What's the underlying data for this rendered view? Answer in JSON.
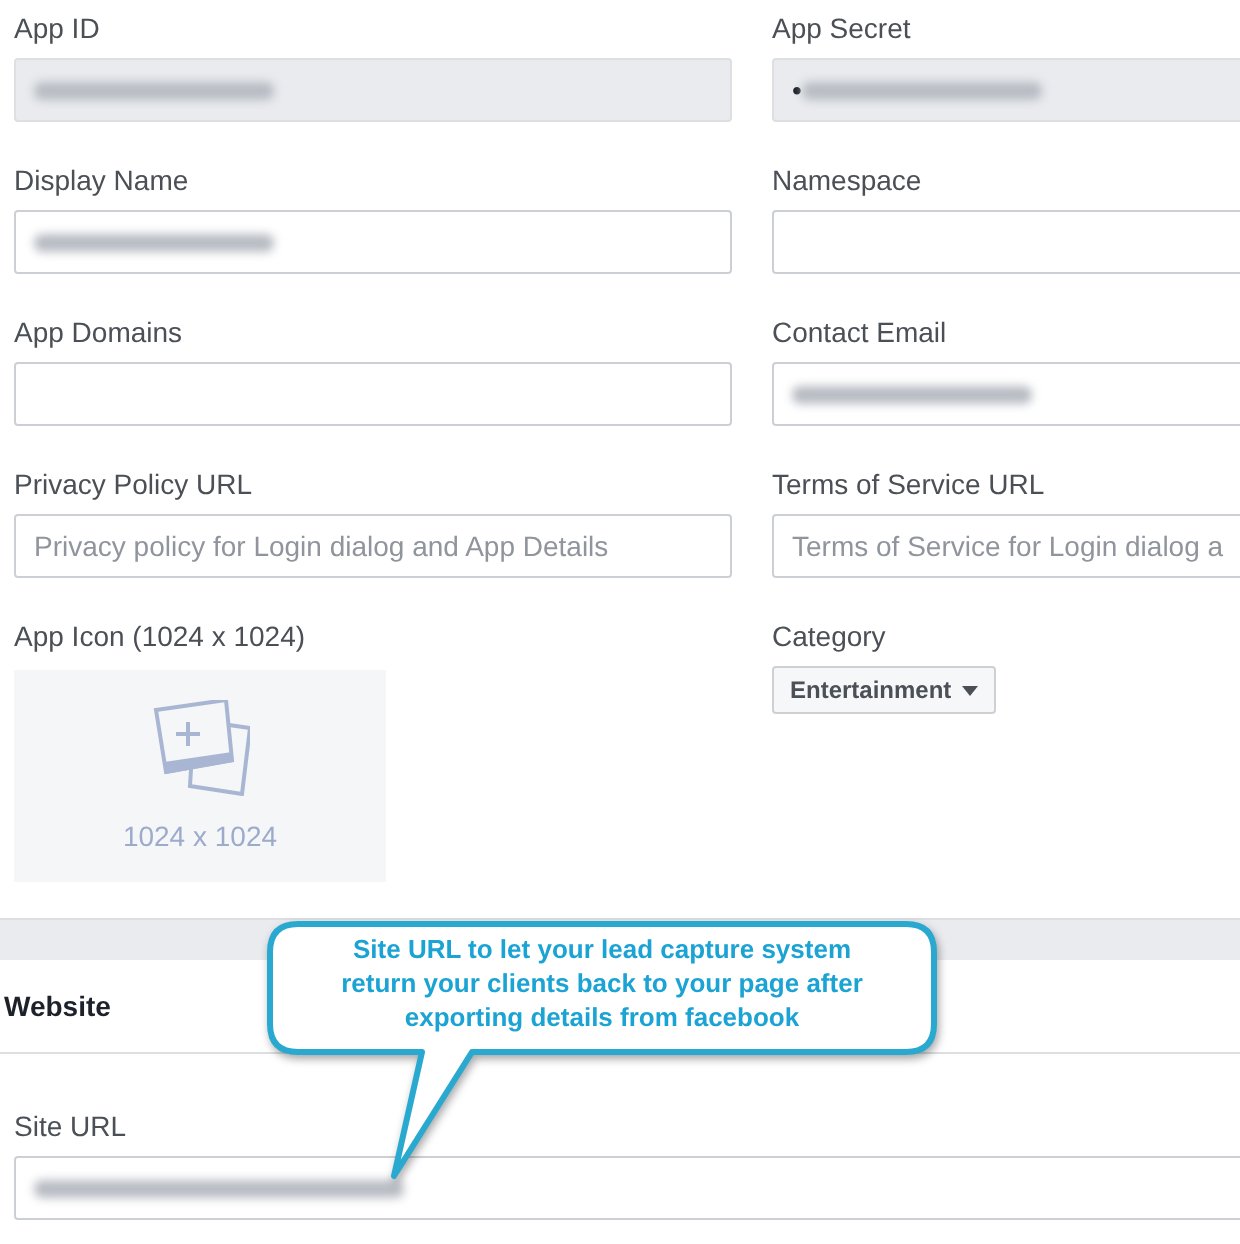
{
  "fields": [
    {
      "label": "App ID",
      "kind": "readonly",
      "redacted": true
    },
    {
      "label": "App Secret",
      "kind": "readonly",
      "value": "•",
      "redacted": true
    },
    {
      "label": "Display Name",
      "kind": "text",
      "redacted": true
    },
    {
      "label": "Namespace",
      "kind": "text"
    },
    {
      "label": "App Domains",
      "kind": "text"
    },
    {
      "label": "Contact Email",
      "kind": "text",
      "redacted": true
    },
    {
      "label": "Privacy Policy URL",
      "kind": "text",
      "placeholder": "Privacy policy for Login dialog and App Details"
    },
    {
      "label": "Terms of Service URL",
      "kind": "text",
      "placeholder": "Terms of Service for Login dialog a"
    }
  ],
  "app_icon": {
    "label": "App Icon (1024 x 1024)",
    "size_text": "1024 x 1024"
  },
  "category": {
    "label": "Category",
    "value": "Entertainment"
  },
  "website": {
    "title": "Website",
    "site_url": {
      "label": "Site URL",
      "redacted": true
    }
  },
  "callout": {
    "text": "Site URL to let your lead capture system return your clients back to your page after exporting details from facebook"
  }
}
